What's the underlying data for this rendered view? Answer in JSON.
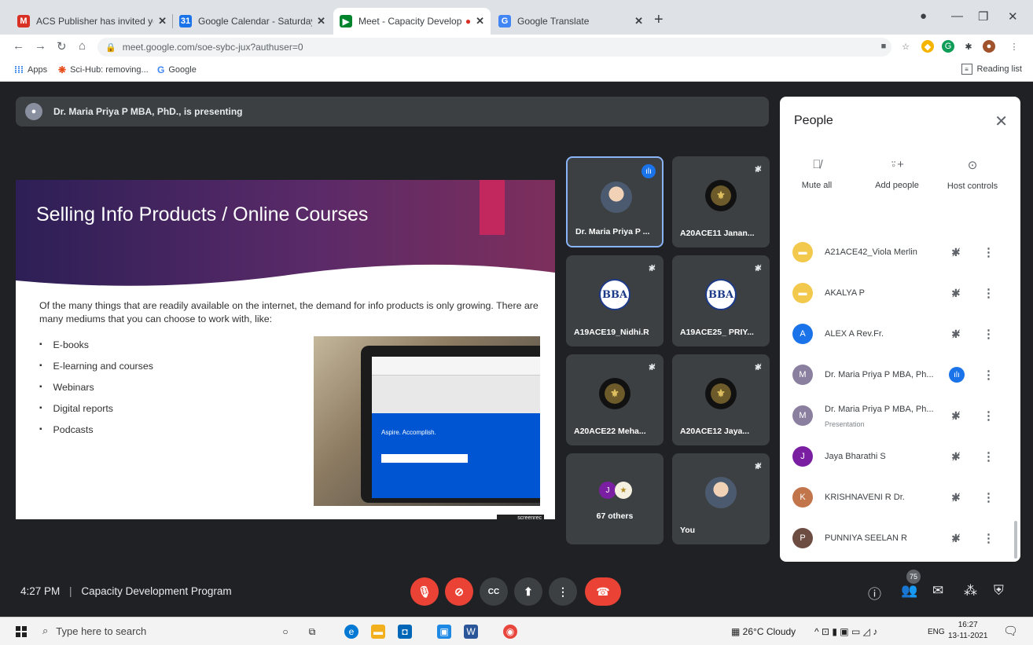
{
  "browser": {
    "tabs": [
      {
        "title": "ACS Publisher has invited you to",
        "favicon": "gmail-icon",
        "fav_char": "M",
        "fav_color": "#d93025",
        "active": false
      },
      {
        "title": "Google Calendar - Saturday, Nov",
        "favicon": "calendar-icon",
        "fav_char": "31",
        "fav_color": "#1a73e8",
        "active": false
      },
      {
        "title": "Meet - Capacity Developme",
        "favicon": "meet-icon",
        "fav_char": "▶",
        "fav_color": "#00832d",
        "active": true
      },
      {
        "title": "Google Translate",
        "favicon": "translate-icon",
        "fav_char": "G",
        "fav_color": "#4285f4",
        "active": false
      }
    ],
    "url": "meet.google.com/soe-sybc-jux?authuser=0",
    "bookmarks": [
      {
        "label": "Apps",
        "icon": "apps-grid-icon"
      },
      {
        "label": "Sci-Hub: removing...",
        "icon": "scihub-icon"
      },
      {
        "label": "Google",
        "icon": "google-icon"
      }
    ],
    "reading_list": "Reading list"
  },
  "meet": {
    "presenter_banner": "Dr. Maria Priya P MBA, PhD., is presenting",
    "slide": {
      "title": "Selling Info Products / Online Courses",
      "intro": "Of the many things that are readily available on the internet, the demand for info products is only growing. There are many mediums that you can choose to work with, like:",
      "bullets": [
        "E-books",
        "E-learning and courses",
        "Webinars",
        "Digital reports",
        "Podcasts"
      ],
      "photo_text": "Aspire. Accomplish.",
      "watermark": "screenrec"
    },
    "tiles": [
      {
        "name": "Dr. Maria Priya P ...",
        "avatar": "photo",
        "speaking": true,
        "muted": false
      },
      {
        "name": "A20ACE11 Janan...",
        "avatar": "emblem",
        "speaking": false,
        "muted": true
      },
      {
        "name": "A19ACE19_Nidhi.R",
        "avatar": "bba",
        "avatar_text": "BBA",
        "speaking": false,
        "muted": true
      },
      {
        "name": "A19ACE25_ PRIY...",
        "avatar": "bba",
        "avatar_text": "BBA",
        "speaking": false,
        "muted": true
      },
      {
        "name": "A20ACE22 Meha...",
        "avatar": "emblem",
        "speaking": false,
        "muted": true
      },
      {
        "name": "A20ACE12 Jaya...",
        "avatar": "emblem",
        "speaking": false,
        "muted": true
      },
      {
        "name": "67 others",
        "avatar": "group",
        "group_initial": "J",
        "speaking": false,
        "muted": false
      },
      {
        "name": "You",
        "avatar": "photo",
        "speaking": false,
        "muted": true
      }
    ],
    "meeting_time": "4:27 PM",
    "meeting_name": "Capacity Development Program",
    "controls": [
      {
        "name": "mic-off-button",
        "icon": "🎙",
        "color": "red"
      },
      {
        "name": "camera-off-button",
        "icon": "⊘",
        "color": "red"
      },
      {
        "name": "captions-button",
        "icon": "CC",
        "color": "grey"
      },
      {
        "name": "present-button",
        "icon": "⬆",
        "color": "grey"
      },
      {
        "name": "more-options-button",
        "icon": "⋮",
        "color": "grey"
      }
    ],
    "end_call_icon": "☎",
    "participant_count": "75"
  },
  "people_panel": {
    "title": "People",
    "actions": [
      {
        "label": "Mute all",
        "icon": "mute-all-icon",
        "glyph": "🎙"
      },
      {
        "label": "Add people",
        "icon": "add-person-icon",
        "glyph": "👤+"
      },
      {
        "label": "Host controls",
        "icon": "host-controls-icon",
        "glyph": "⚙"
      }
    ],
    "participants": [
      {
        "name": "A21ACE42_Viola Merlin",
        "initial": "▬",
        "color": "#f2c94c",
        "sub": "",
        "speaking": false
      },
      {
        "name": "AKALYA P",
        "initial": "▬",
        "color": "#f2c94c",
        "sub": "",
        "speaking": false
      },
      {
        "name": "ALEX A Rev.Fr.",
        "initial": "A",
        "color": "#1a73e8",
        "sub": "",
        "speaking": false
      },
      {
        "name": "Dr. Maria Priya P MBA, Ph...",
        "initial": "M",
        "color": "#8a7f9e",
        "sub": "",
        "speaking": true
      },
      {
        "name": "Dr. Maria Priya P MBA, Ph...",
        "initial": "M",
        "color": "#8a7f9e",
        "sub": "Presentation",
        "speaking": false
      },
      {
        "name": "Jaya Bharathi S",
        "initial": "J",
        "color": "#7b1fa2",
        "sub": "",
        "speaking": false
      },
      {
        "name": "KRISHNAVENI R Dr.",
        "initial": "K",
        "color": "#c2754a",
        "sub": "",
        "speaking": false
      },
      {
        "name": "PUNNIYA SEELAN R",
        "initial": "P",
        "color": "#6d4c41",
        "sub": "",
        "speaking": false
      }
    ]
  },
  "taskbar": {
    "search_placeholder": "Type here to search",
    "weather": "26°C Cloudy",
    "language": "ENG",
    "time": "16:27",
    "date": "13-11-2021"
  }
}
